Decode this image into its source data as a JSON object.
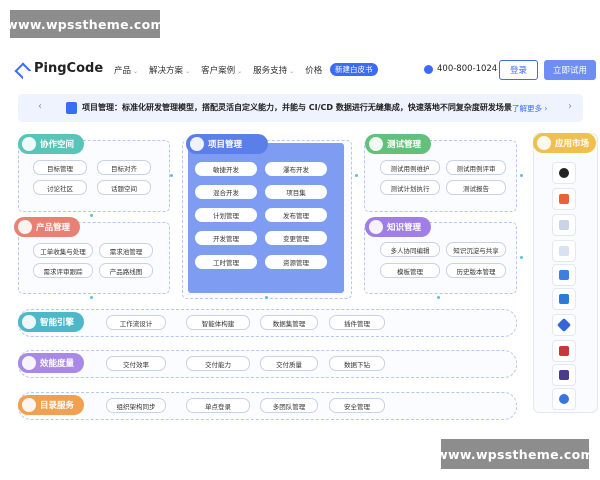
{
  "watermark": "www.wpsstheme.com",
  "brand": "PingCode",
  "nav": {
    "items": [
      "产品",
      "解决方案",
      "客户案例",
      "服务支持",
      "价格"
    ],
    "whitepaper": "新建白皮书",
    "phone": "400-800-1024",
    "login": "登录",
    "trial": "立即试用"
  },
  "banner": {
    "title": "项目管理：标准化研发管理模型，搭配灵活自定义能力，并能与 CI/CD 数据进行无缝集成，快速落地不同复杂度研发场景",
    "more": "了解更多 ›"
  },
  "collab": {
    "title": "协作空间",
    "chips": [
      "目标管理",
      "目标对齐",
      "讨论社区",
      "话题空间"
    ]
  },
  "product": {
    "title": "产品管理",
    "chips": [
      "工单收集与处理",
      "需求池管理",
      "需求评审跟踪",
      "产品路线图"
    ]
  },
  "project": {
    "title": "项目管理",
    "chips": [
      "敏捷开发",
      "瀑布开发",
      "混合开发",
      "项目集",
      "计划管理",
      "发布管理",
      "开发管理",
      "变更管理",
      "工时管理",
      "资源管理"
    ]
  },
  "testing": {
    "title": "测试管理",
    "chips": [
      "测试用例维护",
      "测试用例评审",
      "测试计划执行",
      "测试报告"
    ]
  },
  "knowledge": {
    "title": "知识管理",
    "chips": [
      "多人协同编辑",
      "知识沉淀与共享",
      "模板管理",
      "历史版本管理"
    ]
  },
  "rows": [
    {
      "title": "智能引擎",
      "chips": [
        "工作流设计",
        "智能体构建",
        "数据集管理",
        "插件管理"
      ],
      "color": "#4fb8c8"
    },
    {
      "title": "效能度量",
      "chips": [
        "交付效率",
        "交付能力",
        "交付质量",
        "数据下钻"
      ],
      "color": "#a88ae6"
    },
    {
      "title": "目录服务",
      "chips": [
        "组织架构同步",
        "单点登录",
        "多团队管理",
        "安全管理"
      ],
      "color": "#f0a050"
    }
  ],
  "market": {
    "title": "应用市场",
    "icons": [
      "github-icon",
      "gitlab-icon",
      "jenkins-icon",
      "jira-icon",
      "confluence-icon",
      "vscode-icon",
      "gocd-icon",
      "gitee-icon",
      "kubernetes-icon",
      "cloud-icon"
    ]
  },
  "colors": {
    "primary": "#3b6cf6",
    "collab": "#58c5b8",
    "product": "#e98074",
    "project": "#5b7fe8",
    "testing": "#62c07a",
    "knowledge": "#9f7ee6",
    "market": "#f0c04e"
  }
}
